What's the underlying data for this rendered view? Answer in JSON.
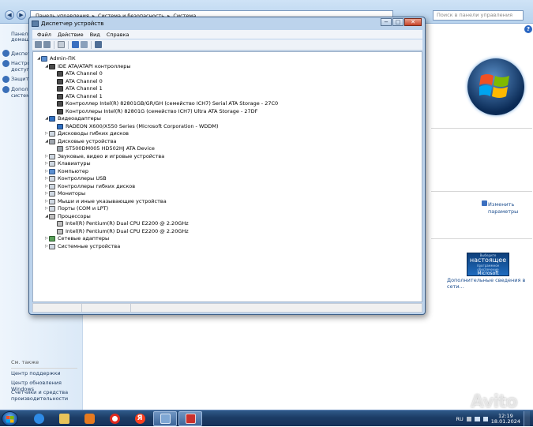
{
  "control_panel": {
    "breadcrumb": [
      "Панель управления",
      "Система и безопасность",
      "Система"
    ],
    "search_placeholder": "Поиск в панели управления",
    "sidebar": {
      "top_items": [
        "Панель",
        "домаш",
        "Диспет",
        "Настро",
        "доступа",
        "Защита",
        "Дополн",
        "систем"
      ],
      "see_also": "См. также",
      "bottom_items": [
        "Центр поддержки",
        "Центр обновления Windows",
        "Счетчики и средства",
        "производительности"
      ]
    },
    "change_params": [
      "Изменить",
      "параметры"
    ],
    "genuine": [
      "Выберите",
      "настоящее",
      "программное обеспечение",
      "Microsoft"
    ],
    "more_info": "Дополнительные сведения в сети..."
  },
  "device_manager": {
    "title": "Диспетчер устройств",
    "menu": [
      "Файл",
      "Действие",
      "Вид",
      "Справка"
    ],
    "window_buttons": {
      "min": "−",
      "max": "□",
      "close": "✕"
    },
    "tree": [
      {
        "label": "Admin-ПК",
        "level": 0,
        "expander": "◢",
        "icon": "computer-icon"
      },
      {
        "label": "IDE ATA/ATAPI контроллеры",
        "level": 1,
        "expander": "◢",
        "icon": "ide-controller-icon"
      },
      {
        "label": "ATA Channel 0",
        "level": 2,
        "expander": "",
        "icon": "ide-controller-icon"
      },
      {
        "label": "ATA Channel 0",
        "level": 2,
        "expander": "",
        "icon": "ide-controller-icon"
      },
      {
        "label": "ATA Channel 1",
        "level": 2,
        "expander": "",
        "icon": "ide-controller-icon"
      },
      {
        "label": "ATA Channel 1",
        "level": 2,
        "expander": "",
        "icon": "ide-controller-icon"
      },
      {
        "label": "Контроллер Intel(R) 82801GB/GR/GH (семейство ICH7) Serial ATA Storage - 27C0",
        "level": 2,
        "expander": "",
        "icon": "ide-controller-icon"
      },
      {
        "label": "Контроллеры Intel(R) 82801G (семейство ICH7) Ultra ATA Storage - 27DF",
        "level": 2,
        "expander": "",
        "icon": "ide-controller-icon"
      },
      {
        "label": "Видеоадаптеры",
        "level": 1,
        "expander": "◢",
        "icon": "display-adapter-icon"
      },
      {
        "label": "RADEON X600/X550 Series (Microsoft Corporation - WDDM)",
        "level": 2,
        "expander": "",
        "icon": "display-adapter-icon"
      },
      {
        "label": "Дисководы гибких дисков",
        "level": 1,
        "expander": "▷",
        "icon": "floppy-drive-icon"
      },
      {
        "label": "Дисковые устройства",
        "level": 1,
        "expander": "◢",
        "icon": "disk-drive-icon"
      },
      {
        "label": "ST500DM005 HD502HJ ATA Device",
        "level": 2,
        "expander": "",
        "icon": "disk-drive-icon"
      },
      {
        "label": "Звуковые, видео и игровые устройства",
        "level": 1,
        "expander": "▷",
        "icon": "sound-device-icon"
      },
      {
        "label": "Клавиатуры",
        "level": 1,
        "expander": "▷",
        "icon": "keyboard-icon"
      },
      {
        "label": "Компьютер",
        "level": 1,
        "expander": "▷",
        "icon": "computer-icon"
      },
      {
        "label": "Контроллеры USB",
        "level": 1,
        "expander": "▷",
        "icon": "usb-icon"
      },
      {
        "label": "Контроллеры гибких дисков",
        "level": 1,
        "expander": "▷",
        "icon": "floppy-controller-icon"
      },
      {
        "label": "Мониторы",
        "level": 1,
        "expander": "▷",
        "icon": "monitor-icon"
      },
      {
        "label": "Мыши и иные указывающие устройства",
        "level": 1,
        "expander": "▷",
        "icon": "mouse-icon"
      },
      {
        "label": "Порты (COM и LPT)",
        "level": 1,
        "expander": "▷",
        "icon": "port-icon"
      },
      {
        "label": "Процессоры",
        "level": 1,
        "expander": "◢",
        "icon": "processor-icon"
      },
      {
        "label": "Intel(R) Pentium(R) Dual  CPU  E2200  @ 2.20GHz",
        "level": 2,
        "expander": "",
        "icon": "processor-icon"
      },
      {
        "label": "Intel(R) Pentium(R) Dual  CPU  E2200  @ 2.20GHz",
        "level": 2,
        "expander": "",
        "icon": "processor-icon"
      },
      {
        "label": "Сетевые адаптеры",
        "level": 1,
        "expander": "▷",
        "icon": "network-adapter-icon"
      },
      {
        "label": "Системные устройства",
        "level": 1,
        "expander": "▷",
        "icon": "system-device-icon"
      }
    ]
  },
  "taskbar": {
    "apps": [
      "internet-explorer-icon",
      "file-explorer-icon",
      "media-player-icon",
      "yandex-browser-icon",
      "yandex-icon",
      "control-panel-icon",
      "device-manager-icon"
    ],
    "language": "RU",
    "time": "12:19",
    "date": "18.01.2024"
  },
  "watermark": "Avito"
}
